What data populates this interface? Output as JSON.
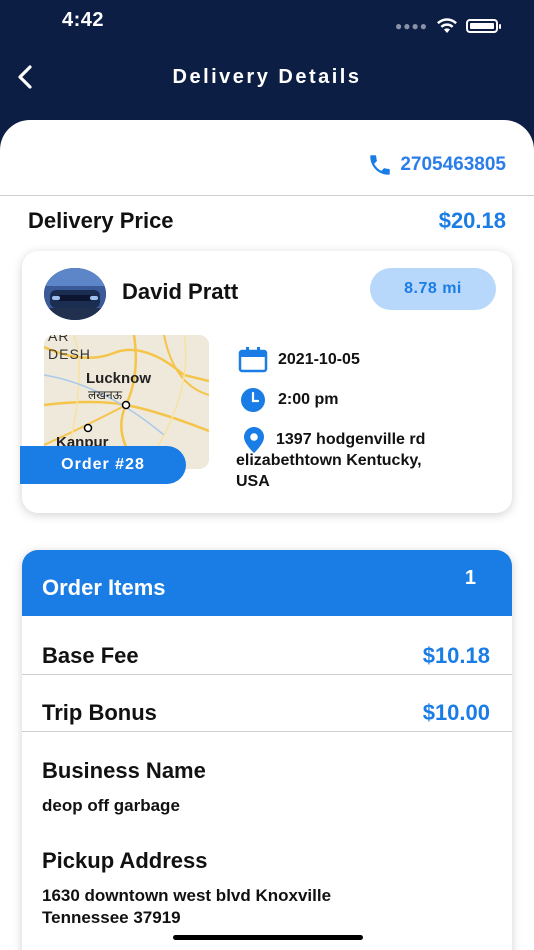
{
  "status_bar": {
    "time": "4:42",
    "icons": [
      "signal-dots-icon",
      "wifi-icon",
      "battery-icon"
    ]
  },
  "nav": {
    "title": "Delivery Details",
    "back_icon": "chevron-left-icon"
  },
  "contact": {
    "phone": "2705463805",
    "icon": "phone-icon"
  },
  "delivery_price": {
    "label": "Delivery Price",
    "value": "$20.18"
  },
  "driver": {
    "name": "David Pratt",
    "distance": "8.78 mi",
    "order_label": "Order #28"
  },
  "map": {
    "labels": [
      "AR",
      "DESH",
      "Lucknow",
      "लखनऊ",
      "Kanpur"
    ]
  },
  "trip": {
    "date": "2021-10-05",
    "time": "2:00 pm",
    "address_line1": "1397 hodgenville rd",
    "address_line2": "elizabethtown Kentucky,",
    "address_line3": "USA"
  },
  "order_items": {
    "title": "Order Items",
    "count": "1",
    "base_fee_label": "Base Fee",
    "base_fee_value": "$10.18",
    "trip_bonus_label": "Trip Bonus",
    "trip_bonus_value": "$10.00",
    "business_name_heading": "Business Name",
    "business_name": "deop off garbage",
    "pickup_heading": "Pickup Address",
    "pickup_line1": "1630 downtown west blvd Knoxville",
    "pickup_line2": "Tennessee 37919"
  },
  "colors": {
    "header": "#0d1e45",
    "accent": "#1a7de6",
    "badge": "#b7d7fb"
  }
}
